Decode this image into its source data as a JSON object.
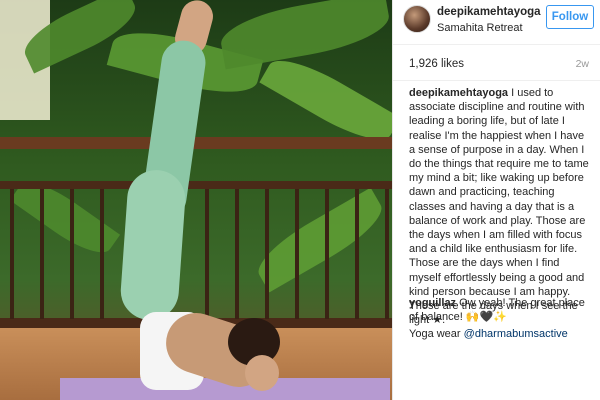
{
  "post": {
    "username": "deepikamehtayoga",
    "location": "Samahita Retreat",
    "follow_label": "Follow",
    "likes": "1,926 likes",
    "age": "2w"
  },
  "caption": {
    "username": "deepikamehtayoga",
    "text": "I used to associate discipline and routine with leading a boring life, but of late I realise I'm the happiest when I have a sense of purpose in a day. When I do the things that require me to tame my mind a bit; like waking up before dawn and practicing, teaching classes and having a day that is a balance of work and play. Those are the days when I am filled with focus and a child like enthusiasm for life. Those are the days when I find myself effortlessly being a good and kind person because I am happy. Those are the days when I see the light ★.",
    "wear_label": "Yoga wear",
    "mention": "@dharmabumsactive"
  },
  "comments": [
    {
      "username": "yoguillaz",
      "text": "Ow yeah! The great place of balance! 🙌🖤✨"
    }
  ],
  "colors": {
    "follow_blue": "#3897f0",
    "mention_blue": "#003569"
  },
  "icons": {
    "star": "star-icon"
  }
}
